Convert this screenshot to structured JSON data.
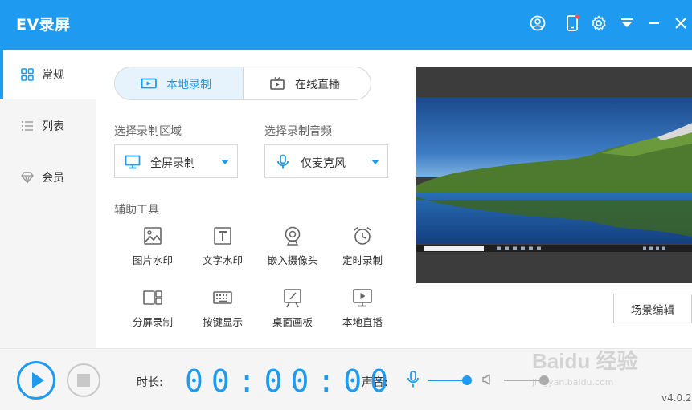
{
  "app": {
    "title": "EV录屏",
    "version": "v4.0.2"
  },
  "sidebar": {
    "items": [
      {
        "label": "常规",
        "icon": "grid-icon",
        "active": true
      },
      {
        "label": "列表",
        "icon": "list-icon",
        "active": false
      },
      {
        "label": "会员",
        "icon": "diamond-icon",
        "active": false
      }
    ]
  },
  "tabs": {
    "local": {
      "label": "本地录制",
      "icon": "camera-icon",
      "active": true
    },
    "live": {
      "label": "在线直播",
      "icon": "tv-icon",
      "active": false
    }
  },
  "record": {
    "area_label": "选择录制区域",
    "area_value": "全屏录制",
    "audio_label": "选择录制音频",
    "audio_value": "仅麦克风"
  },
  "tools": {
    "section_label": "辅助工具",
    "items": [
      {
        "label": "图片水印",
        "icon": "image-icon"
      },
      {
        "label": "文字水印",
        "icon": "text-icon"
      },
      {
        "label": "嵌入摄像头",
        "icon": "webcam-icon"
      },
      {
        "label": "定时录制",
        "icon": "alarm-clock-icon"
      },
      {
        "label": "分屏录制",
        "icon": "split-screen-icon"
      },
      {
        "label": "按键显示",
        "icon": "keyboard-icon"
      },
      {
        "label": "桌面画板",
        "icon": "drawing-board-icon"
      },
      {
        "label": "本地直播",
        "icon": "monitor-play-icon"
      }
    ]
  },
  "preview": {
    "scene_button": "场景编辑"
  },
  "bottom": {
    "duration_label": "时长:",
    "timer": "00:00:00",
    "sound_label": "声音:",
    "mic_level": 0.95,
    "speaker_level": 1.0
  },
  "watermark": {
    "main": "Baidu 经验",
    "sub": "jingyan.baidu.com"
  },
  "colors": {
    "accent": "#1e9bf0",
    "sidebar_bg": "#f5f5f5",
    "title_bar": "#1e9bf0"
  }
}
